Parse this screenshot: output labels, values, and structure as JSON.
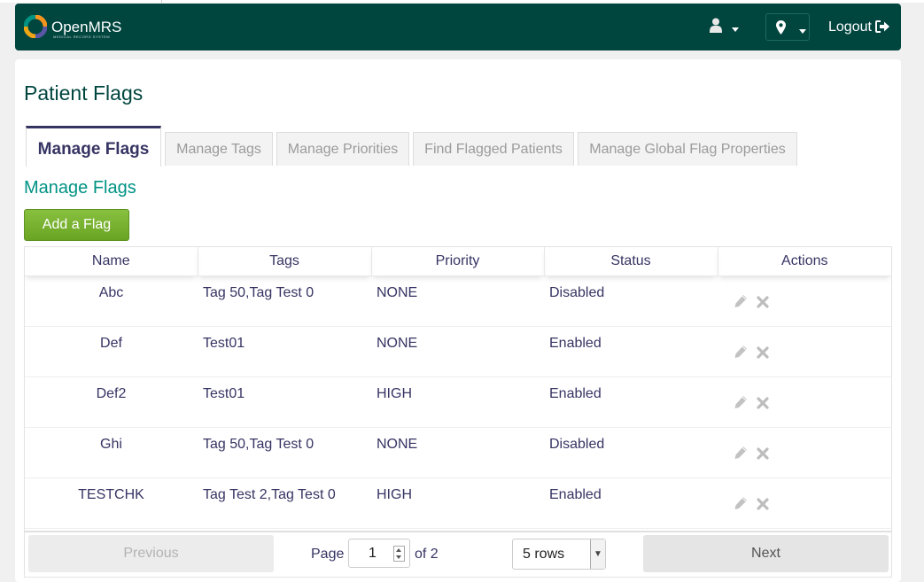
{
  "header": {
    "logo_text": "OpenMRS",
    "logo_subtitle": "MEDICAL RECORD SYSTEM",
    "logout_label": "Logout",
    "user_icon": "user-icon",
    "location_icon": "map-marker-icon"
  },
  "page": {
    "title": "Patient Flags",
    "section_title": "Manage Flags",
    "add_button": "Add a Flag"
  },
  "tabs": [
    {
      "label": "Manage Flags",
      "active": true
    },
    {
      "label": "Manage Tags",
      "active": false
    },
    {
      "label": "Manage Priorities",
      "active": false
    },
    {
      "label": "Find Flagged Patients",
      "active": false
    },
    {
      "label": "Manage Global Flag Properties",
      "active": false
    }
  ],
  "table": {
    "columns": [
      "Name",
      "Tags",
      "Priority",
      "Status",
      "Actions"
    ],
    "rows": [
      {
        "name": "Abc",
        "tags": "Tag 50,Tag Test 0",
        "priority": "NONE",
        "status": "Disabled"
      },
      {
        "name": "Def",
        "tags": "Test01",
        "priority": "NONE",
        "status": "Enabled"
      },
      {
        "name": "Def2",
        "tags": "Test01",
        "priority": "HIGH",
        "status": "Enabled"
      },
      {
        "name": "Ghi",
        "tags": "Tag 50,Tag Test 0",
        "priority": "NONE",
        "status": "Disabled"
      },
      {
        "name": "TESTCHK",
        "tags": "Tag Test 2,Tag Test 0",
        "priority": "HIGH",
        "status": "Enabled"
      }
    ]
  },
  "pager": {
    "previous": "Previous",
    "page_label": "Page",
    "page_value": "1",
    "of_label": "of 2",
    "rows_value": "5 rows",
    "next": "Next"
  },
  "colors": {
    "header_bg": "#00463f",
    "title": "#00463f",
    "section_title": "#009384",
    "add_button": "#7ab532",
    "text": "#363463"
  }
}
